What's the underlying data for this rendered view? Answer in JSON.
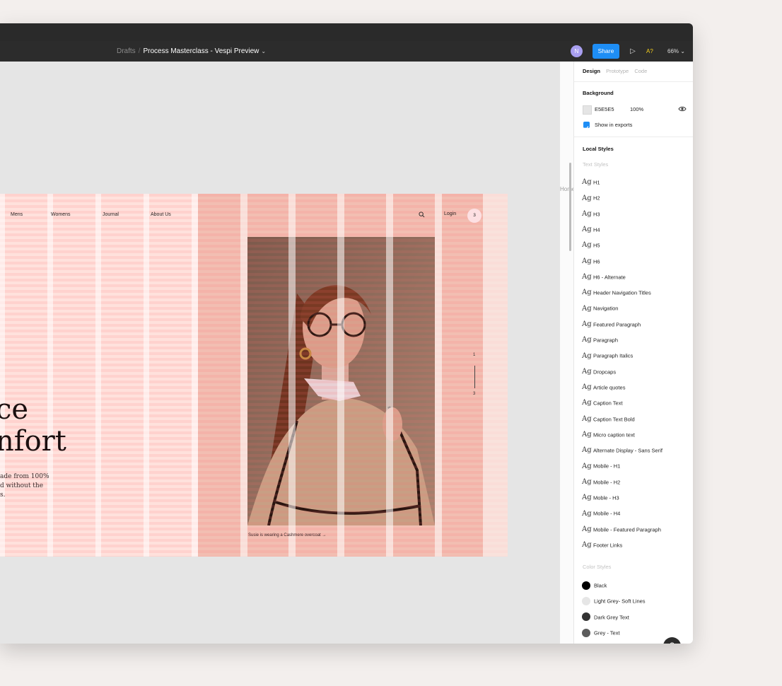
{
  "toolbar": {
    "breadcrumb_parent": "Drafts",
    "breadcrumb_sep": "/",
    "file_name": "Process Masterclass - Vespi Preview",
    "avatar_initial": "N",
    "share_label": "Share",
    "accessibility_label": "A?",
    "zoom_label": "66%"
  },
  "canvas": {
    "home_label": "Home",
    "background_color": "#E5E5E5",
    "site": {
      "nav": [
        "Mens",
        "Womens",
        "Journal",
        "About Us"
      ],
      "login": "Login",
      "cart_count": "3",
      "hero_title": "ce\nnfort",
      "hero_sub": "ade from 100%\nd without the\ns.",
      "slide_current": "1",
      "slide_total": "3",
      "caption": "Susie is wearing a Cashmere overcoat  →"
    }
  },
  "panel": {
    "tabs": [
      {
        "label": "Design",
        "active": true
      },
      {
        "label": "Prototype",
        "active": false
      },
      {
        "label": "Code",
        "active": false
      }
    ],
    "background": {
      "title": "Background",
      "hex": "E5E5E5",
      "opacity": "100%",
      "show_in_exports": "Show in exports"
    },
    "local_styles": {
      "title": "Local Styles",
      "text_styles_title": "Text Styles",
      "text_styles": [
        "H1",
        "H2",
        "H3",
        "H4",
        "H5",
        "H6",
        "H6 - Alternate",
        "Header Navigation Titles",
        "Navigation",
        "Featured Paragraph",
        "Paragraph",
        "Paragraph Italics",
        "Dropcaps",
        "Article quotes",
        "Caption Text",
        "Caption Text Bold",
        "Micro caption text",
        "Alternate Display - Sans Serif",
        "Mobile - H1",
        "Mobile - H2",
        "Moble - H3",
        "Mobile - H4",
        "Mobile - Featured Paragraph",
        "Footer Links"
      ],
      "ag_glyph": "Ag",
      "color_styles_title": "Color Styles",
      "color_styles": [
        {
          "name": "Black",
          "color": "#000000"
        },
        {
          "name": "Light Grey- Soft Lines",
          "color": "#E6E6E6"
        },
        {
          "name": "Dark Grey Text",
          "color": "#333333"
        },
        {
          "name": "Grey - Text",
          "color": "#5C5C5C"
        }
      ]
    }
  },
  "help_label": "?"
}
